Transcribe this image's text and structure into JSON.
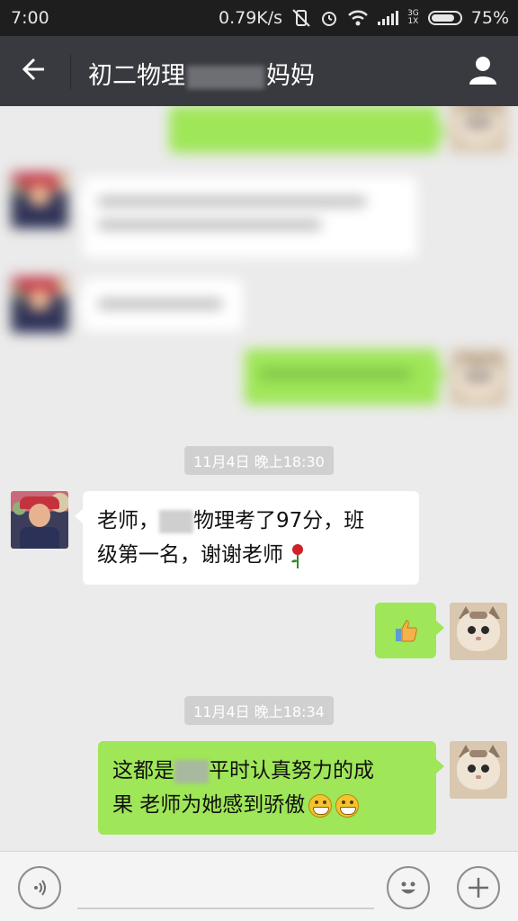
{
  "status_bar": {
    "time": "7:00",
    "speed": "0.79K/s",
    "network": "3G",
    "network2": "1X",
    "battery": "75%"
  },
  "header": {
    "title_left": "初二物理",
    "title_right": "妈妈"
  },
  "messages": [
    {
      "type": "timestamp",
      "text": "11月4日 晚上18:30"
    },
    {
      "type": "incoming",
      "line1_pre": "老师，",
      "line1_post": "物理考了97分，班",
      "line2": "级第一名，谢谢老师"
    },
    {
      "type": "outgoing",
      "content": "thumbs-up"
    },
    {
      "type": "timestamp",
      "text": "11月4日 晚上18:34"
    },
    {
      "type": "outgoing",
      "line1_pre": "这都是",
      "line1_post": "平时认真努力的成",
      "line2": "果 老师为她感到骄傲"
    }
  ],
  "icons": {
    "back": "back-arrow-icon",
    "profile": "person-icon",
    "voice": "voice-icon",
    "emoji": "emoji-icon",
    "more": "plus-icon"
  },
  "colors": {
    "titlebar": "#393a3f",
    "outgoing_bubble": "#9fe658",
    "incoming_bubble": "#ffffff",
    "background": "#ebebeb"
  }
}
